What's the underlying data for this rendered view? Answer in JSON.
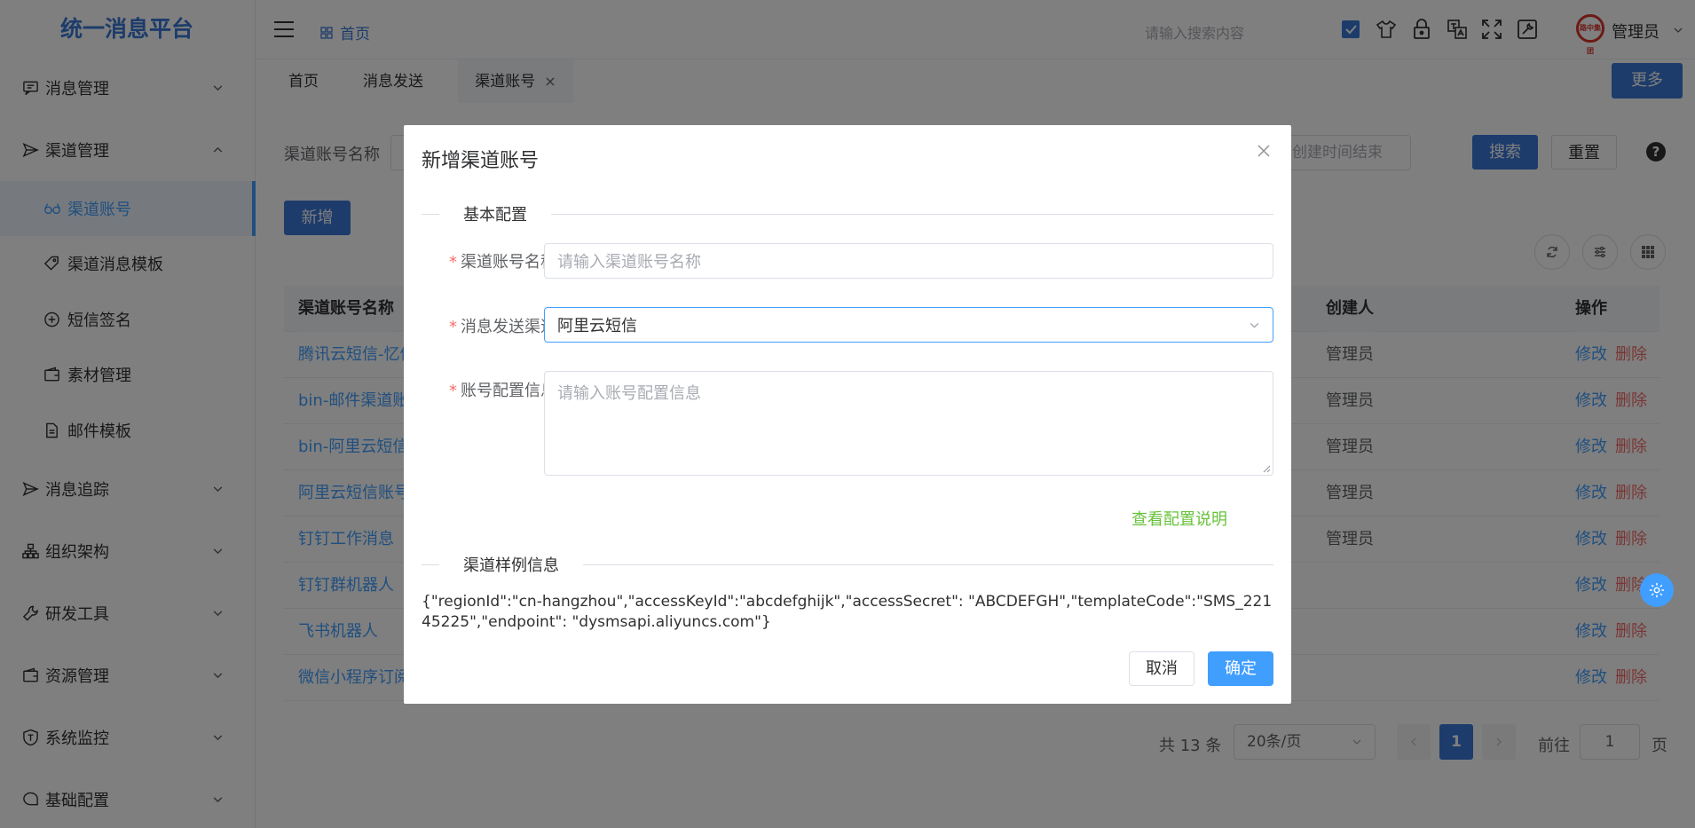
{
  "app": {
    "title": "统一消息平台"
  },
  "sidebar": {
    "items": [
      {
        "label": "消息管理"
      },
      {
        "label": "渠道管理"
      },
      {
        "label": "渠道账号"
      },
      {
        "label": "渠道消息模板"
      },
      {
        "label": "短信签名"
      },
      {
        "label": "素材管理"
      },
      {
        "label": "邮件模板"
      },
      {
        "label": "消息追踪"
      },
      {
        "label": "组织架构"
      },
      {
        "label": "研发工具"
      },
      {
        "label": "资源管理"
      },
      {
        "label": "系统监控"
      },
      {
        "label": "基础配置"
      }
    ]
  },
  "header": {
    "breadcrumb_home": "首页",
    "search_placeholder": "请输入搜索内容",
    "user": "管理员",
    "avatar_text": "路中集团"
  },
  "tabs": {
    "items": [
      {
        "label": "首页"
      },
      {
        "label": "消息发送"
      },
      {
        "label": "渠道账号"
      }
    ],
    "close": "×",
    "more": "更多"
  },
  "filter": {
    "name_label": "渠道账号名称",
    "date_placeholder": "择创建时间结束",
    "search": "搜索",
    "reset": "重置",
    "add": "新增"
  },
  "table": {
    "headers": {
      "name": "渠道账号名称",
      "creator": "创建人",
      "ops": "操作"
    },
    "rows": [
      {
        "name": "腾讯云短信-忆信",
        "creator": "管理员"
      },
      {
        "name": "bin-邮件渠道账号",
        "creator": "管理员"
      },
      {
        "name": "bin-阿里云短信",
        "creator": "管理员"
      },
      {
        "name": "阿里云短信账号",
        "creator": "管理员"
      },
      {
        "name": "钉钉工作消息",
        "creator": "管理员"
      },
      {
        "name": "钉钉群机器人",
        "creator": ""
      },
      {
        "name": "飞书机器人",
        "creator": ""
      },
      {
        "name": "微信小程序订阅",
        "creator": ""
      }
    ],
    "edit": "修改",
    "delete": "删除"
  },
  "pagination": {
    "total": "共 13 条",
    "page_size": "20条/页",
    "current": "1",
    "goto_label": "前往",
    "goto_value": "1",
    "page_suffix": "页"
  },
  "dialog": {
    "title": "新增渠道账号",
    "section_basic": "基本配置",
    "name_label": "渠道账号名称",
    "name_placeholder": "请输入渠道账号名称",
    "channel_label": "消息发送渠道",
    "channel_value": "阿里云短信",
    "config_label": "账号配置信息",
    "config_placeholder": "请输入账号配置信息",
    "config_link": "查看配置说明",
    "section_sample": "渠道样例信息",
    "sample_text": "{\"regionId\":\"cn-hangzhou\",\"accessKeyId\":\"abcdefghijk\",\"accessSecret\": \"ABCDEFGH\",\"templateCode\":\"SMS_22145225\",\"endpoint\": \"dysmsapi.aliyuncs.com\"}",
    "cancel": "取消",
    "confirm": "确定",
    "required_mark": "*"
  },
  "colors": {
    "primary": "#3a78d6",
    "link": "#409eff",
    "danger": "#f56c6c",
    "success": "#67c23a"
  }
}
